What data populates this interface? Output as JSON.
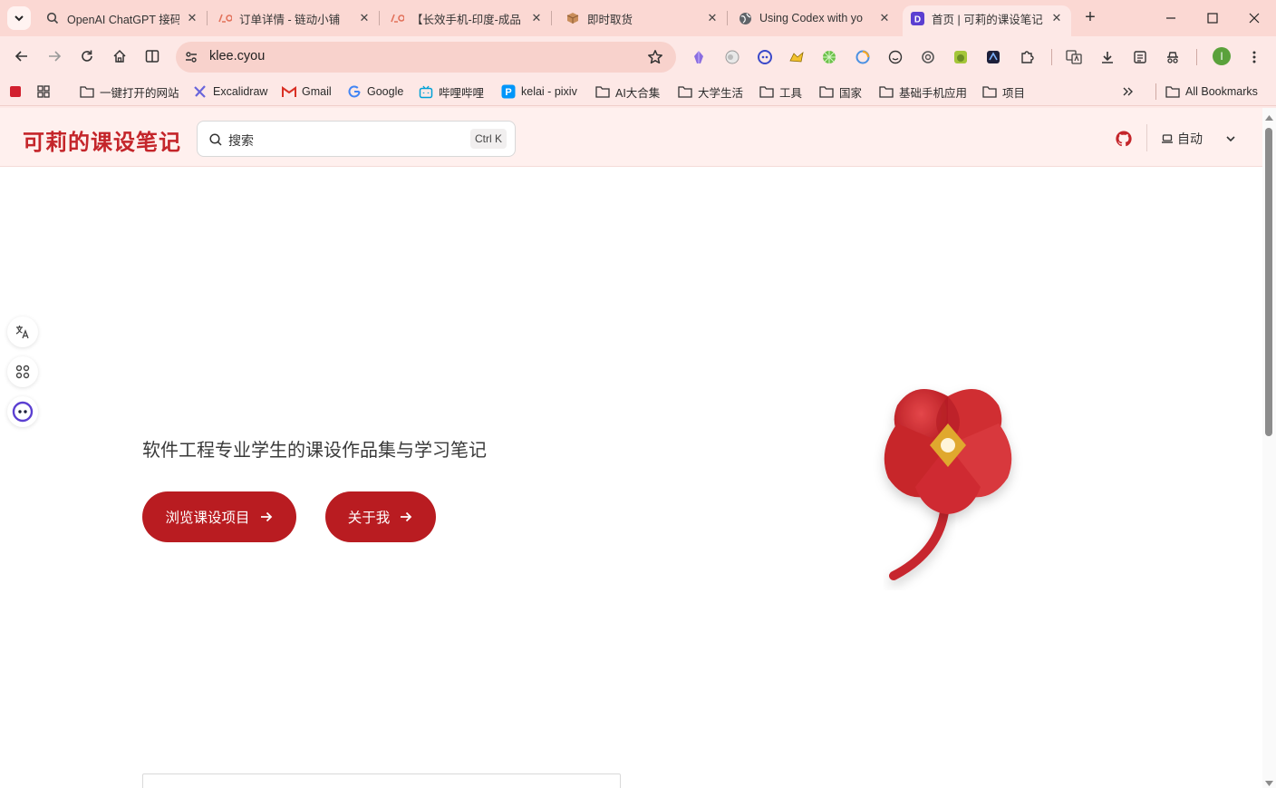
{
  "browser": {
    "tabs": [
      {
        "title": "OpenAI ChatGPT 接码",
        "favicon": "search-icon"
      },
      {
        "title": "订单详情 - 链动小铺",
        "favicon": "ld-logo-icon"
      },
      {
        "title": "【长效手机-印度-成品",
        "favicon": "ld-logo-icon"
      },
      {
        "title": "即时取货",
        "favicon": "package-icon"
      },
      {
        "title": "Using Codex with yo",
        "favicon": "globe-icon"
      },
      {
        "title": "首页 | 可莉的课设笔记",
        "favicon": "d-logo-icon",
        "active": true
      }
    ],
    "url": "klee.cyou",
    "profile_initial": "I",
    "bookmarks": [
      {
        "label": "一键打开的网站",
        "icon": "folder-icon"
      },
      {
        "label": "Excalidraw",
        "icon": "excalidraw-icon"
      },
      {
        "label": "Gmail",
        "icon": "gmail-icon"
      },
      {
        "label": "Google",
        "icon": "google-icon"
      },
      {
        "label": "哔哩哔哩",
        "icon": "bilibili-icon"
      },
      {
        "label": "kelai - pixiv",
        "icon": "pixiv-icon"
      },
      {
        "label": "AI大合集",
        "icon": "folder-icon"
      },
      {
        "label": "大学生活",
        "icon": "folder-icon"
      },
      {
        "label": "工具",
        "icon": "folder-icon"
      },
      {
        "label": "国家",
        "icon": "folder-icon"
      },
      {
        "label": "基础手机应用",
        "icon": "folder-icon"
      },
      {
        "label": "项目",
        "icon": "folder-icon"
      }
    ],
    "all_bookmarks": "All Bookmarks",
    "colors": {
      "tab_strip": "#fbd8d3",
      "toolbar": "#fde8e6"
    }
  },
  "site": {
    "logo": "可莉的课设笔记",
    "search": {
      "placeholder": "搜索",
      "shortcut": "Ctrl K"
    },
    "theme_label": "自动",
    "tagline": "软件工程专业学生的课设作品集与学习笔记",
    "buttons": {
      "browse": "浏览课设项目",
      "about": "关于我"
    },
    "colors": {
      "brand": "#c4252a",
      "button": "#b91c21",
      "header_bg": "#fff0ee"
    }
  }
}
